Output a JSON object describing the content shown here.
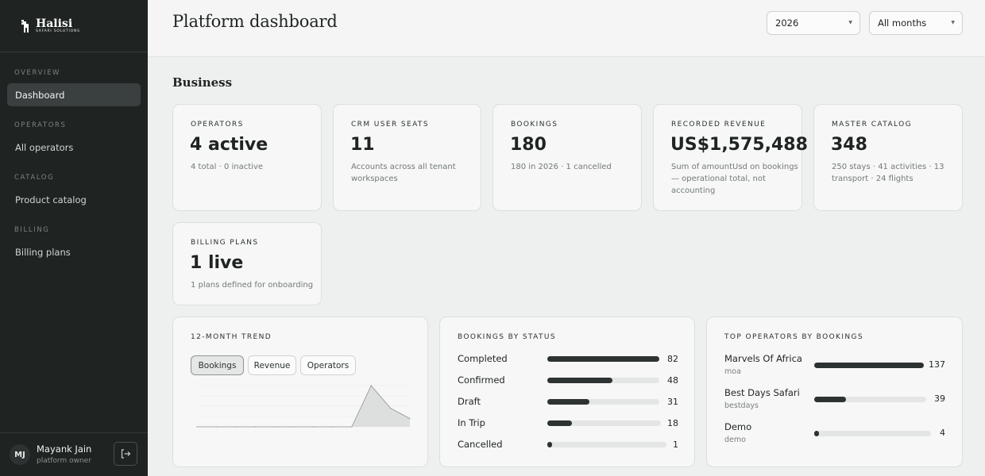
{
  "brand": {
    "name": "Halisi",
    "sub": "SAFARI SOLUTIONS"
  },
  "nav": [
    {
      "section": "OVERVIEW",
      "label": "Dashboard",
      "active": true
    },
    {
      "section": "OPERATORS",
      "label": "All operators",
      "active": false
    },
    {
      "section": "CATALOG",
      "label": "Product catalog",
      "active": false
    },
    {
      "section": "BILLING",
      "label": "Billing plans",
      "active": false
    }
  ],
  "user": {
    "initials": "MJ",
    "name": "Mayank Jain",
    "role": "platform owner"
  },
  "header": {
    "title": "Platform dashboard",
    "year": "2026",
    "months": "All months"
  },
  "business": {
    "title": "Business",
    "cards": [
      {
        "label": "OPERATORS",
        "value": "4 active",
        "sub": "4 total · 0 inactive"
      },
      {
        "label": "CRM USER SEATS",
        "value": "11",
        "sub": "Accounts across all tenant workspaces"
      },
      {
        "label": "BOOKINGS",
        "value": "180",
        "sub": "180 in 2026 · 1 cancelled"
      },
      {
        "label": "RECORDED REVENUE",
        "value": "US$1,575,488",
        "sub": "Sum of amountUsd on bookings — operational total, not accounting"
      },
      {
        "label": "MASTER CATALOG",
        "value": "348",
        "sub": "250 stays · 41 activities · 13 transport · 24 flights"
      },
      {
        "label": "BILLING PLANS",
        "value": "1 live",
        "sub": "1 plans defined for onboarding"
      }
    ]
  },
  "trend": {
    "title": "12-MONTH TREND",
    "tabs": [
      "Bookings",
      "Revenue",
      "Operators"
    ],
    "active_tab": "Bookings"
  },
  "chart_data": {
    "type": "area",
    "series": [
      {
        "values": [
          0,
          0,
          0,
          0,
          0,
          0,
          0,
          0,
          0,
          100,
          45,
          20
        ]
      }
    ],
    "ylim": [
      0,
      100
    ]
  },
  "status": {
    "title": "BOOKINGS BY STATUS",
    "rows": [
      {
        "label": "Completed",
        "value": "82",
        "fraction": 1.0
      },
      {
        "label": "Confirmed",
        "value": "48",
        "fraction": 0.585
      },
      {
        "label": "Draft",
        "value": "31",
        "fraction": 0.378
      },
      {
        "label": "In Trip",
        "value": "18",
        "fraction": 0.22
      },
      {
        "label": "Cancelled",
        "value": "1",
        "fraction": 0.012
      }
    ]
  },
  "top_operators": {
    "title": "TOP OPERATORS BY BOOKINGS",
    "rows": [
      {
        "name": "Marvels Of Africa",
        "slug": "moa",
        "value": "137",
        "fraction": 1.0
      },
      {
        "name": "Best Days Safari",
        "slug": "bestdays",
        "value": "39",
        "fraction": 0.285
      },
      {
        "name": "Demo",
        "slug": "demo",
        "value": "4",
        "fraction": 0.03
      }
    ]
  }
}
